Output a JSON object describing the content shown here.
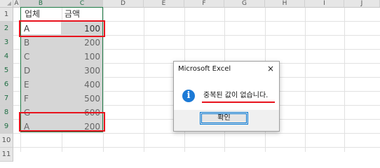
{
  "columns": [
    "A",
    "B",
    "C",
    "D",
    "E",
    "F",
    "G",
    "H",
    "I",
    "J"
  ],
  "rows": [
    "1",
    "2",
    "3",
    "4",
    "5",
    "6",
    "7",
    "8",
    "9",
    "10",
    "11"
  ],
  "headers": {
    "vendor": "업체",
    "amount": "금액"
  },
  "data_rows": [
    {
      "vendor": "A",
      "amount": "100"
    },
    {
      "vendor": "B",
      "amount": "200"
    },
    {
      "vendor": "C",
      "amount": "100"
    },
    {
      "vendor": "D",
      "amount": "300"
    },
    {
      "vendor": "E",
      "amount": "400"
    },
    {
      "vendor": "F",
      "amount": "500"
    },
    {
      "vendor": "G",
      "amount": "600"
    },
    {
      "vendor": "A",
      "amount": "200"
    }
  ],
  "dialog": {
    "title": "Microsoft Excel",
    "close_icon": "×",
    "info_icon_glyph": "i",
    "message": "중복된 값이 없습니다.",
    "ok_label": "확인"
  },
  "colors": {
    "highlight_red": "#e8131d",
    "selection_green": "#1f7a45",
    "info_blue": "#1c7ad6"
  }
}
